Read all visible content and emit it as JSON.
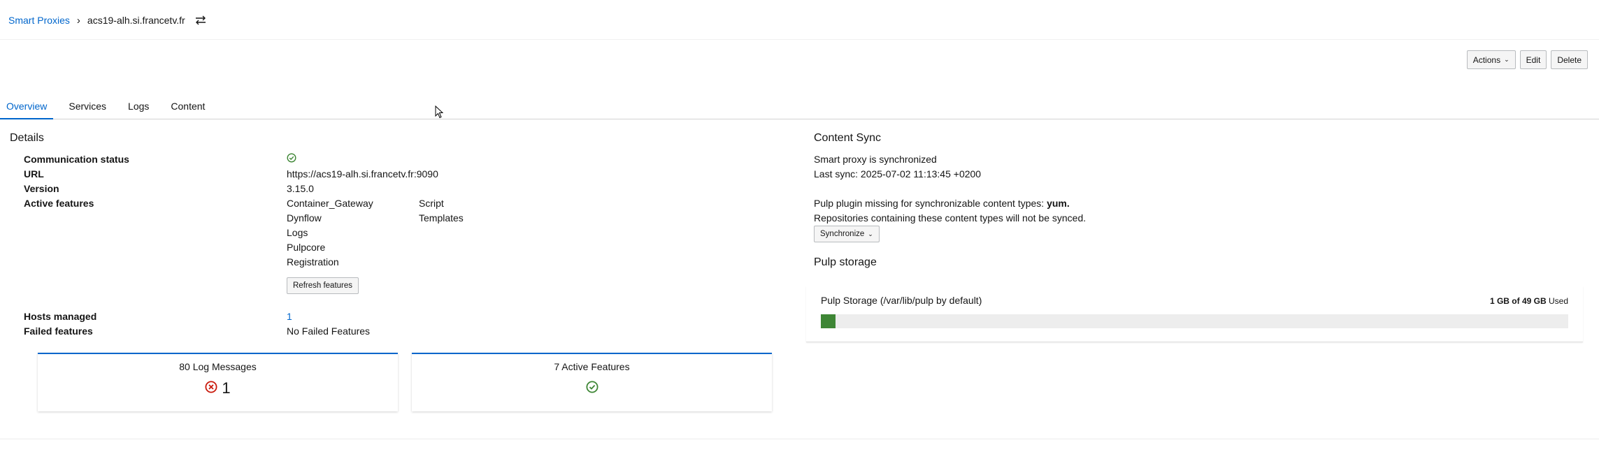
{
  "breadcrumb": {
    "root": "Smart Proxies",
    "separator": "›",
    "current": "acs19-alh.si.francetv.fr",
    "switch_icon": "exchange-icon"
  },
  "toolbar": {
    "actions_label": "Actions",
    "edit_label": "Edit",
    "delete_label": "Delete"
  },
  "tabs": [
    {
      "label": "Overview",
      "active": true
    },
    {
      "label": "Services",
      "active": false
    },
    {
      "label": "Logs",
      "active": false
    },
    {
      "label": "Content",
      "active": false
    }
  ],
  "details": {
    "title": "Details",
    "communication_status_label": "Communication status",
    "communication_status_icon": "check-circle-icon",
    "url_label": "URL",
    "url_value": "https://acs19-alh.si.francetv.fr:9090",
    "version_label": "Version",
    "version_value": "3.15.0",
    "active_features_label": "Active features",
    "features_col1": [
      "Container_Gateway",
      "Dynflow",
      "Logs",
      "Pulpcore",
      "Registration"
    ],
    "features_col2": [
      "Script",
      "Templates"
    ],
    "refresh_button": "Refresh features",
    "hosts_managed_label": "Hosts managed",
    "hosts_managed_value": "1",
    "failed_features_label": "Failed features",
    "failed_features_value": "No Failed Features"
  },
  "cards": {
    "log_messages_title": "80 Log Messages",
    "log_error_count": "1",
    "log_error_icon": "error-circle-icon",
    "active_features_title": "7 Active Features",
    "active_features_icon": "check-circle-icon"
  },
  "content_sync": {
    "title": "Content Sync",
    "status": "Smart proxy is synchronized",
    "last_sync": "Last sync: 2025-07-02 11:13:45 +0200",
    "missing_prefix": "Pulp plugin missing for synchronizable content types: ",
    "missing_types": "yum.",
    "warning": "Repositories containing these content types will not be synced.",
    "synchronize_button": "Synchronize"
  },
  "pulp_storage": {
    "title": "Pulp storage",
    "label": "Pulp Storage (/var/lib/pulp by default)",
    "used_amount": "1 GB of 49 GB",
    "used_suffix": "Used",
    "fraction_used": 0.02
  },
  "colors": {
    "link": "#0066cc",
    "success": "#3e8635",
    "danger": "#c9190b",
    "progress_fill": "#3e8635"
  }
}
